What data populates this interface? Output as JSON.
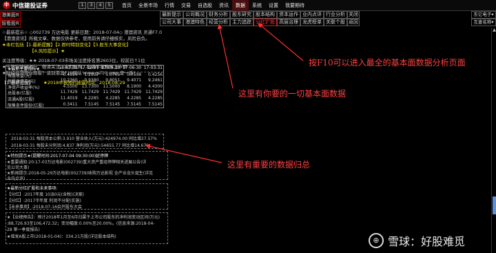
{
  "titlebar": {
    "app_name": "中信建投证券",
    "mini_buttons": [
      "1",
      "3",
      "4",
      "5"
    ],
    "menu": [
      "首页",
      "全景市场",
      "行情",
      "交易",
      "自选股",
      "资讯",
      "数据",
      "系统",
      "设置",
      "我要期待"
    ],
    "active_menu_index": 6
  },
  "left": {
    "top_buttons": [
      "港美股R",
      "智看股R"
    ],
    "tools": [
      "R",
      "⊞",
      "⊟",
      "⊠",
      "⊡",
      "⊛",
      "⊜",
      "✎"
    ]
  },
  "tabs": [
    {
      "label": "最新提示",
      "selected": false
    },
    {
      "label": "公司概况",
      "selected": false
    },
    {
      "label": "财务分析",
      "selected": false
    },
    {
      "label": "股东研究",
      "selected": false
    },
    {
      "label": "股本结构",
      "selected": false
    },
    {
      "label": "资本运作",
      "selected": false
    },
    {
      "label": "业内点评",
      "selected": false
    },
    {
      "label": "行业分析",
      "selected": false
    },
    {
      "label": "关闭",
      "selected": false
    },
    {
      "label": "公司大事",
      "selected": false
    },
    {
      "label": "港澳特色",
      "selected": false
    },
    {
      "label": "经营分析",
      "selected": false
    },
    {
      "label": "主力追踪",
      "selected": false
    },
    {
      "label": "分红扩股",
      "selected": true
    },
    {
      "label": "高层治理",
      "selected": false
    },
    {
      "label": "龙虎榜单",
      "selected": false
    },
    {
      "label": "关联个股",
      "selected": false
    },
    {
      "label": "返回",
      "selected": false
    }
  ],
  "right_buttons": [
    "东亿电子▾",
    "互查名称▾"
  ],
  "content": {
    "l1": "☆最新提示☆ ◇002739 万达电影 更新日期：2018-07-04◇ 港澳资讯 灵通F7.0",
    "l2": "【港澳资讯】所载文章、数据仅供参考，使用前务请仔细核实，风险自负。",
    "l3": "★本栏包括【1.最新提醒】【2.即时特别变化】【3.股东大事变化】",
    "l4": "【4.风险提示】★",
    "l5": "关注度等级：★★ 2018-07-03市场关注度排名第2603位，较前日↑1位",
    "l6": "★卡牌快捷键进行，敬请关注，实力机构、私募牛散推荐上市中",
    "l7": "★财经视频等你观看？请到港澳F10网站 www.gsf10.com 查一查！",
    "l8": "【1.最新提醒】",
    "l8b": "★2018中报预约披露时间：2018-08-29",
    "table": {
      "header": [
        "★最新主要指标★",
        "18-03-31",
        "17-12-31",
        "17-09-30",
        "17-06-30",
        "17-03-31"
      ],
      "rows": [
        [
          "每股收益(元)",
          "0.4654",
          "1.2907",
          "1.0766",
          "0.7598",
          "0.4256"
        ],
        [
          "每股净资产(元)",
          "10.2360",
          "9.9380",
          "9.8051",
          "9.4071",
          "9.2461"
        ],
        [
          "净资产收益率(%)",
          "4.5500",
          "13.7300",
          "11.5000",
          "8.1900",
          "4.4300"
        ],
        [
          "总股本(亿股)",
          "11.7429",
          "11.7429",
          "11.7429",
          "11.7429",
          "11.7429"
        ],
        [
          "流通A股(亿股)",
          "11.4019",
          "4.2285",
          "4.2285",
          "4.2285",
          "4.2285"
        ],
        [
          "限售条件股份(亿股)",
          "0.3411",
          "7.5145",
          "7.5145",
          "7.5145",
          "7.5145"
        ]
      ]
    },
    "perf1a": "2018-03-31  每股资本公积:3.910  营业收入(万元):424974.00  同比增27.57%",
    "perf2a": "2018-03-31  每股未分利润:4.837  净利润(万元):54655.77  同比增14.67%",
    "ev_head": "★特别提示★(提醒时间:2017-07-04 09:30:00)延停牌",
    "ev_l2": "★重要通知:20:17-03万达电影(002739)重大资产重组停牌相关进展公告(详",
    "ev_l3": "见公司大事)",
    "ev_l4": "★新闻提示:2018-05-29万达电影(002739)收购万达影视 全产业龙头诞生(详见",
    "ev_l5": "业内点评)",
    "div_head": "★最新分红扩股和未来事项:",
    "div_l2": "【分红】:2017年度  10派0元(含税)(决案)",
    "div_l3": "【分红】:2017半年度  利润不分配(实施)",
    "div_l4": "【未来事项】:2018-07-16召开股东大会",
    "risk_l1": "★【业绩预告】：预计2018年1月至6月归属于上市公司股东的净利润变动区间(万元)",
    "risk_l2": ":88,726.93至106,472.32；变动幅度:0.00%至20.00%。(信息来源:2018-04-",
    "risk_l3": "28 第一季度报告)",
    "risk_l4": "★增发A股上市(2018-01-04)：334.21万股(详见股本结构)"
  },
  "annotations": {
    "a1": "按F10可以进入最全的基本面数据分析页面",
    "a2": "这里有你要的一切基本面数据",
    "a3": "这里有重要的数据归总"
  },
  "watermark": {
    "icon": "⊕",
    "text": "雪球：好股难觅"
  },
  "colors": {
    "accent": "#c00000",
    "annotation": "#ff4040",
    "scroll_thumb": "#5c8fd6"
  }
}
